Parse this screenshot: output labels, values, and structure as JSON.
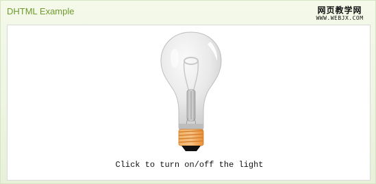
{
  "header": {
    "title": "DHTML Example",
    "watermark_main": "网页教学网",
    "watermark_sub": "WWW.WEBJX.COM"
  },
  "demo": {
    "caption": "Click to turn on/off the light",
    "light_state": "off",
    "bulb_icon": "lightbulb-icon",
    "colors": {
      "glass": "#e8e8e8",
      "base": "#f5a34f",
      "tip": "#111111",
      "title": "#6f9a2d"
    }
  }
}
